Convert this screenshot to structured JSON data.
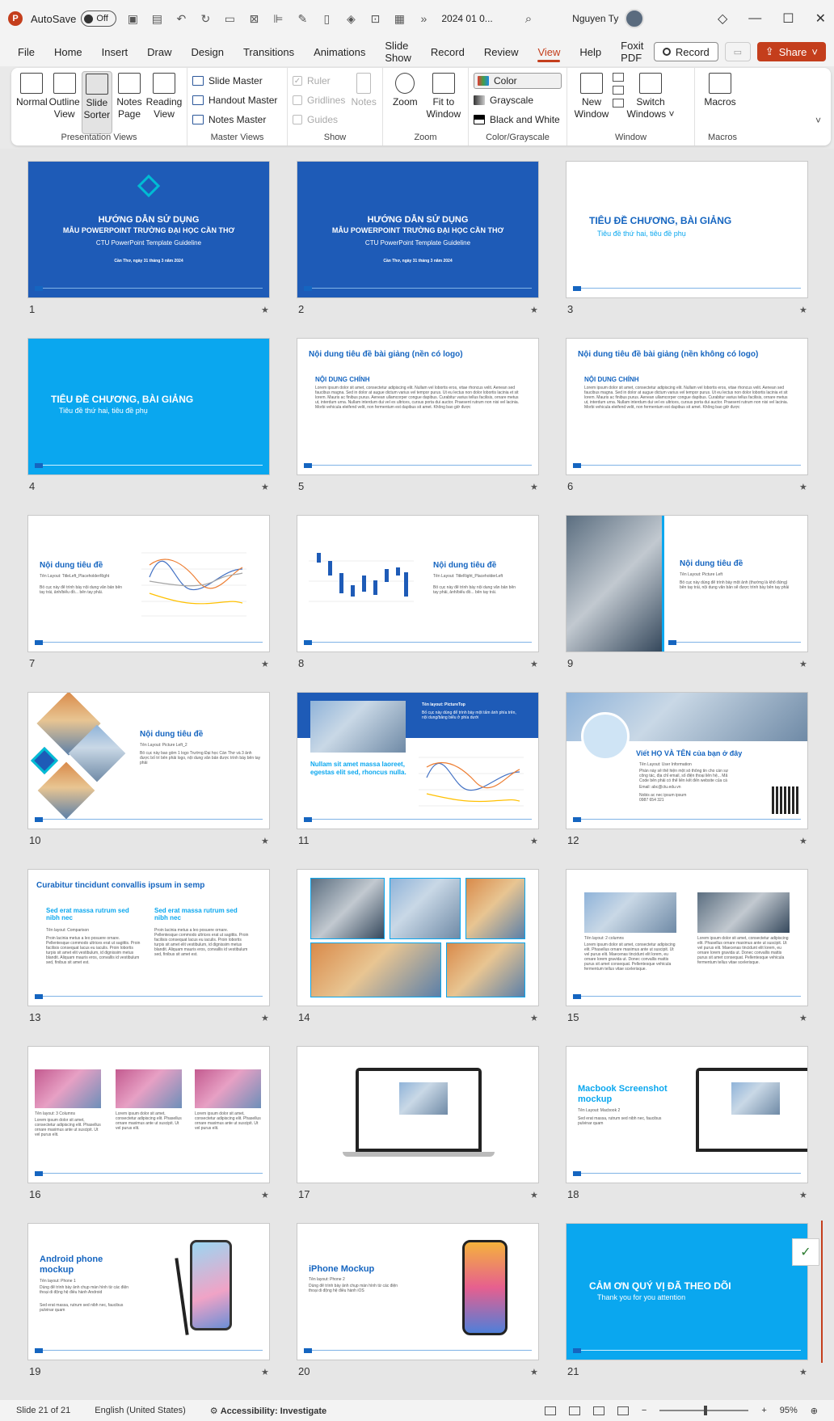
{
  "titlebar": {
    "autosave_label": "AutoSave",
    "autosave_state": "Off",
    "filename": "2024 01 0...",
    "more": "»",
    "user_name": "Nguyen Ty"
  },
  "tabs": [
    "File",
    "Home",
    "Insert",
    "Draw",
    "Design",
    "Transitions",
    "Animations",
    "Slide Show",
    "Record",
    "Review",
    "View",
    "Help",
    "Foxit PDF"
  ],
  "active_tab": "View",
  "tab_actions": {
    "record": "Record",
    "share": "Share"
  },
  "ribbon": {
    "presentation_views": {
      "label": "Presentation Views",
      "buttons": [
        {
          "l1": "Normal",
          "l2": ""
        },
        {
          "l1": "Outline",
          "l2": "View"
        },
        {
          "l1": "Slide",
          "l2": "Sorter"
        },
        {
          "l1": "Notes",
          "l2": "Page"
        },
        {
          "l1": "Reading",
          "l2": "View"
        }
      ]
    },
    "master_views": {
      "label": "Master Views",
      "items": [
        "Slide Master",
        "Handout Master",
        "Notes Master"
      ]
    },
    "show": {
      "label": "Show",
      "items": [
        "Ruler",
        "Gridlines",
        "Guides"
      ],
      "notes": "Notes"
    },
    "zoom": {
      "label": "Zoom",
      "zoom": "Zoom",
      "fit_l1": "Fit to",
      "fit_l2": "Window"
    },
    "color": {
      "label": "Color/Grayscale",
      "items": [
        "Color",
        "Grayscale",
        "Black and White"
      ]
    },
    "window": {
      "label": "Window",
      "new_l1": "New",
      "new_l2": "Window",
      "switch_l1": "Switch",
      "switch_l2": "Windows ˅"
    },
    "macros": {
      "label": "Macros",
      "button": "Macros"
    }
  },
  "slides": {
    "s1": {
      "num": "1",
      "t1": "HƯỚNG DẪN SỬ DỤNG",
      "t2": "MẪU POWERPOINT TRƯỜNG ĐẠI HỌC CẦN THƠ",
      "t3": "CTU PowerPoint Template Guideline",
      "t4": "Cần Thơ, ngày 31 tháng 3 năm 2024"
    },
    "s2": {
      "num": "2",
      "t1": "HƯỚNG DẪN SỬ DỤNG",
      "t2": "MẪU POWERPOINT TRƯỜNG ĐẠI HỌC CẦN THƠ",
      "t3": "CTU PowerPoint Template Guideline",
      "t4": "Cần Thơ, ngày 31 tháng 3 năm 2024"
    },
    "s3": {
      "num": "3",
      "t1": "TIÊU ĐỀ CHƯƠNG, BÀI GIẢNG",
      "t2": "Tiêu đề thứ hai, tiêu đề phụ"
    },
    "s4": {
      "num": "4",
      "t1": "TIÊU ĐỀ CHƯƠNG, BÀI GIẢNG",
      "t2": "Tiêu đề thứ hai, tiêu đề phụ"
    },
    "s5": {
      "num": "5",
      "t1": "Nội dung tiêu đề bài giảng (nền có logo)",
      "t2": "NỘI DUNG CHÍNH",
      "body": "Lorem ipsum dolor sit amet, consectetur adipiscing elit. Nullam vel lobortis eros, vitae rhoncus velit. Aenean sed faucibus magna. Sed in dolor at augue dictum varius vel tempor purus. Ut eu lectus non dolor lobortis lacinia et sit lorem. Mauris ac finibus purus. Aenean ullamcorper congue dapibus. Curabitur varius tellus facilisis, ornare metus ut, interdum urna. Nullam interdum dui vel ex ultrices, cursus porta dui auctor. Praesent rutrum non nisi vel lacinia. Morbi vehicula eleifend velit, non fermentum est dapibus sit amet. Không bao giờ được"
    },
    "s6": {
      "num": "6",
      "t1": "Nội dung tiêu đề bài giảng (nền không có logo)",
      "t2": "NỘI DUNG CHÍNH",
      "body": "Lorem ipsum dolor sit amet, consectetur adipiscing elit. Nullam vel lobortis eros, vitae rhoncus velit. Aenean sed faucibus magna. Sed in dolor at augue dictum varius vel tempor purus. Ut eu lectus non dolor lobortis lacinia et sit lorem. Mauris ac finibus purus. Aenean ullamcorper congue dapibus. Curabitur varius tellus facilisis, ornare metus ut, interdum urna. Nullam interdum dui vel ex ultrices, cursus porta dui auctor. Praesent rutrum non nisi vel lacinia. Morbi vehicula eleifend velit, non fermentum est dapibus sit amet. Không bao giờ được"
    },
    "s7": {
      "num": "7",
      "t1": "Nội dung tiêu đề",
      "t2": "Tên Layout: TitleLeft_PlaceholderRight",
      "body": "Bố cục này để trình bày nội dung văn bản bên tay trái, ảnh/biểu đồ... bên tay phải."
    },
    "s8": {
      "num": "8",
      "t1": "Nội dung tiêu đề",
      "t2": "Tên Layout: TitleRight_PlaceholderLeft",
      "body": "Bố cục này để trình bày nội dung văn bản bên tay phải, ảnh/biểu đồ... bên tay trái."
    },
    "s9": {
      "num": "9",
      "t1": "Nội dung tiêu đề",
      "t2": "Tên Layout: Picture Left",
      "body": "Bố cục này dùng để trình bày một ảnh (thường là khổ đứng) bên tay trái, nội dung văn bản sẽ được trình bày bên tay phải"
    },
    "s10": {
      "num": "10",
      "t1": "Nội dung tiêu đề",
      "t2": "Tên Layout: Picture Left_2",
      "body": "Bố cục này bao gồm 1 logo Trường Đại học Cần Thơ và 3 ảnh được bố trí bên phải logo, nội dung văn bản được trình bày bên tay phải"
    },
    "s11": {
      "num": "11",
      "t1": "Tên layout: PictureTop",
      "t2": "Bố cục này dùng để trình bày một tấm ảnh phía trên, nội dung/bảng biểu ở phía dưới",
      "t3": "Nullam sit amet massa laoreet, egestas elit sed, rhoncus nulla."
    },
    "s12": {
      "num": "12",
      "t1": "Viết HỌ VÀ TÊN của bạn ở đây",
      "t2": "Tên Layout: User Information",
      "body": "Phần này sẽ thể hiện một số thông tin cho cán sự công tác, địa chỉ email, số điện thoại liên hệ... Mã Code bên phải có thể liên kết đến website của cá nhân hoặc đơn vị.",
      "email": "Email: abc@ctu.edu.vn",
      "extra": "Nobis ac nec ipsum ipsum 0987 654 321"
    },
    "s13": {
      "num": "13",
      "t1": "Curabitur tincidunt convallis ipsum in semp",
      "c1": "Sed erat massa rutrum sed nibh nec",
      "c2": "Sed erat massa rutrum sed nibh nec",
      "layout": "Tên layout: Comparison",
      "b1": "Proin lacinia metus a leo posuere ornare. Pellentesque commodo ultrices erat ut sagittis. Proin facilisis consequat lacus eu iaculis. Proin lobortis turpis sit amet elit vestibulum, id dignissim metus blandit. Aliquam mauris eros, convallis id vestibulum sed, finibus sit amet est.",
      "b2": "Proin lacinia metus a leo posuere ornare. Pellentesque commodo ultrices erat ut sagittis. Proin facilisis consequat lacus eu iaculis. Proin lobortis turpis sit amet elit vestibulum, id dignissim metus blandit. Aliquam mauris eros, convallis id vestibulum sed, finibus sit amet est."
    },
    "s14": {
      "num": "14"
    },
    "s15": {
      "num": "15",
      "layout": "Tên layout: 2 columns",
      "b1": "Lorem ipsum dolor sit amet, consectetur adipiscing elit. Phasellus ornare maximus ante ut suscipit. Ut vel purus elit. Maecenas tincidunt elit lorem, eu ornare lorem gravida ut. Donec convallis mattis purus sit amet consequat. Pellentesque vehicula fermentum tellus vitae scelerisque.",
      "b2": "Lorem ipsum dolor sit amet, consectetur adipiscing elit. Phasellus ornare maximus ante ut suscipit. Ut vel purus elit. Maecenas tincidunt elit lorem, eu ornare lorem gravida ut. Donec convallis mattis purus sit amet consequat. Pellentesque vehicula fermentum tellus vitae scelerisque."
    },
    "s16": {
      "num": "16",
      "layout": "Tên layout: 3 Columns",
      "b1": "Lorem ipsum dolor sit amet, consectetur adipiscing elit. Phasellus ornare maximus ante ut suscipit. Ut vel purus elit.",
      "b2": "Lorem ipsum dolor sit amet, consectetur adipiscing elit. Phasellus ornare maximus ante ut suscipit. Ut vel purus elit.",
      "b3": "Lorem ipsum dolor sit amet, consectetur adipiscing elit. Phasellus ornare maximus ante ut suscipit. Ut vel purus elit."
    },
    "s17": {
      "num": "17"
    },
    "s18": {
      "num": "18",
      "t1": "Macbook Screenshot mockup",
      "t2": "Tên Layout: Macbook 2",
      "body": "Sed erat massa, rutrum sed nibh nec, faucibus pulvinar quam"
    },
    "s19": {
      "num": "19",
      "t1": "Android phone mockup",
      "t2": "Tên layout: Phone 1",
      "body": "Dùng để trình bày ảnh chụp màn hình từ các điện thoại di động hệ điều hành Android",
      "body2": "Sed erat massa, rutrum sed nibh nec, faucibus pulvinar quam"
    },
    "s20": {
      "num": "20",
      "t1": "iPhone Mockup",
      "t2": "Tên layout: Phone 2",
      "body": "Dùng để trình bày ảnh chụp màn hình từ các điện thoại di động hệ điều hành iOS"
    },
    "s21": {
      "num": "21",
      "t1": "CẢM ƠN QUÝ VỊ ĐÃ THEO DÕI",
      "t2": "Thank you for you attention"
    }
  },
  "star": "★",
  "status": {
    "slide_of": "Slide 21 of 21",
    "language": "English (United States)",
    "accessibility": "Accessibility: Investigate",
    "zoom": "95%",
    "zoom_minus": "−",
    "zoom_plus": "+"
  },
  "colors": {
    "accent": "#c43e1c",
    "slide_blue": "#1e5bb7",
    "slide_cyan": "#0aa7ef",
    "heading_blue": "#1565c0"
  }
}
